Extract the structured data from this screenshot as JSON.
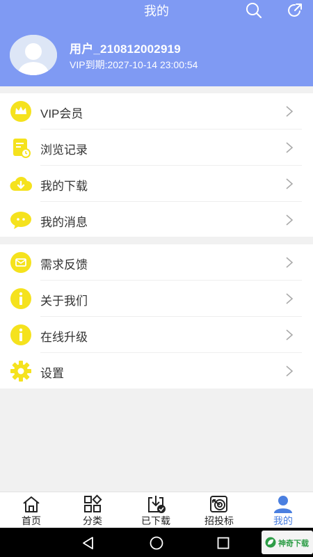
{
  "header": {
    "title": "我的",
    "username": "用户_210812002919",
    "vip_expiry": "VIP到期:2027-10-14 23:00:54"
  },
  "colors": {
    "header_bg": "#7f9af3",
    "icon_yellow": "#f5e21d",
    "active_tab": "#4a7fe0"
  },
  "menu_group_1": [
    {
      "label": "VIP会员",
      "icon": "crown-icon"
    },
    {
      "label": "浏览记录",
      "icon": "history-icon"
    },
    {
      "label": "我的下载",
      "icon": "cloud-download-icon"
    },
    {
      "label": "我的消息",
      "icon": "message-icon"
    }
  ],
  "menu_group_2": [
    {
      "label": "需求反馈",
      "icon": "feedback-icon"
    },
    {
      "label": "关于我们",
      "icon": "info-icon"
    },
    {
      "label": "在线升级",
      "icon": "info-icon"
    },
    {
      "label": "设置",
      "icon": "gear-icon"
    }
  ],
  "tabs": [
    {
      "label": "首页",
      "icon": "home-icon"
    },
    {
      "label": "分类",
      "icon": "category-icon"
    },
    {
      "label": "已下载",
      "icon": "downloaded-icon"
    },
    {
      "label": "招投标",
      "icon": "target-icon"
    },
    {
      "label": "我的",
      "icon": "user-icon",
      "active": true
    }
  ],
  "watermark": {
    "text": "神奇下载"
  }
}
